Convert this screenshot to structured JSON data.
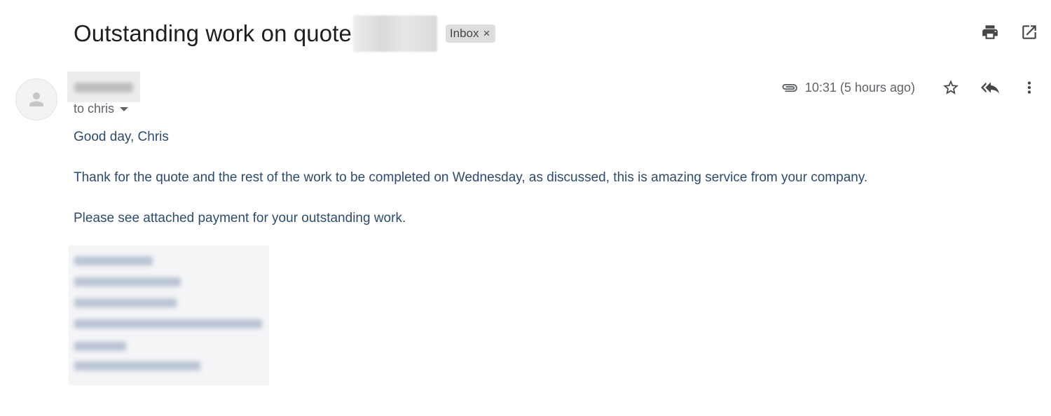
{
  "message": {
    "subject": "Outstanding work on quote",
    "label": "Inbox",
    "label_remove": "×",
    "recipient_line": "to chris",
    "time": "10:31 (5 hours ago)",
    "body": {
      "greeting": "Good day, Chris",
      "paragraph_1": "Thank for the quote and the rest of the work to be completed on Wednesday, as discussed, this is amazing service from your company.",
      "paragraph_2": "Please see attached payment for your outstanding work."
    }
  },
  "icons": {
    "print": "print-icon",
    "open_new_window": "open-in-new-window-icon",
    "attachment": "paperclip-icon",
    "star": "star-icon",
    "reply_all": "reply-all-icon",
    "more": "more-vertical-icon",
    "avatar": "person-icon"
  },
  "colors": {
    "body_text": "#2e4b6e",
    "meta_text": "#5f6368",
    "chip_background": "#dddddd",
    "redaction": "#b9c3d3"
  }
}
